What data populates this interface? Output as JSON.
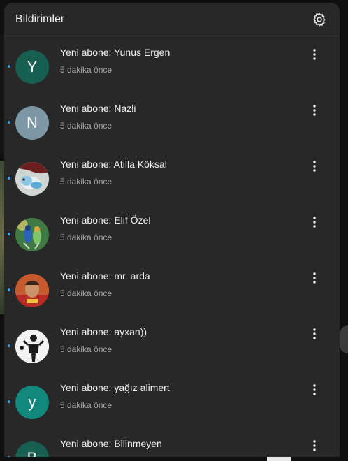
{
  "header": {
    "title": "Bildirimler",
    "settings_icon": "gear-icon"
  },
  "notifications": [
    {
      "avatar_letter": "Y",
      "avatar_color": "#175f51",
      "title": "Yeni abone: Yunus Ergen",
      "time": "5 dakika önce",
      "unread": true
    },
    {
      "avatar_letter": "N",
      "avatar_color": "#7e97a7",
      "title": "Yeni abone: Nazli",
      "time": "5 dakika önce",
      "unread": true
    },
    {
      "avatar_letter": "",
      "avatar_color": "#b9c8cf",
      "title": "Yeni abone: Atilla Köksal",
      "time": "5 dakika önce",
      "unread": true
    },
    {
      "avatar_letter": "",
      "avatar_color": "#2f5e3a",
      "title": "Yeni abone: Elif Özel",
      "time": "5 dakika önce",
      "unread": true
    },
    {
      "avatar_letter": "",
      "avatar_color": "#b0532b",
      "title": "Yeni abone: mr. arda",
      "time": "5 dakika önce",
      "unread": true
    },
    {
      "avatar_letter": "",
      "avatar_color": "#e8e8e8",
      "title": "Yeni abone: ayxan))",
      "time": "5 dakika önce",
      "unread": true
    },
    {
      "avatar_letter": "y",
      "avatar_color": "#12877b",
      "title": "Yeni abone: yağız alimert",
      "time": "5 dakika önce",
      "unread": true
    },
    {
      "avatar_letter": "B",
      "avatar_color": "#175f51",
      "title": "Yeni abone: Bilinmeyen",
      "time": "",
      "unread": true
    }
  ]
}
